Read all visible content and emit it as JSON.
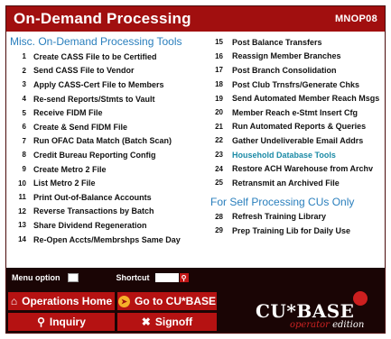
{
  "header": {
    "title": "On-Demand Processing",
    "code": "MNOP08"
  },
  "left": {
    "heading": "Misc. On-Demand Processing Tools",
    "items": [
      {
        "num": "1",
        "label": "Create CASS File to be Certified"
      },
      {
        "num": "2",
        "label": "Send CASS File to Vendor"
      },
      {
        "num": "3",
        "label": "Apply CASS-Cert File to Members"
      },
      {
        "num": "4",
        "label": "Re-send Reports/Stmts to Vault"
      },
      {
        "num": "5",
        "label": "Receive FIDM File"
      },
      {
        "num": "6",
        "label": "Create & Send FIDM File"
      },
      {
        "num": "7",
        "label": "Run OFAC Data Match (Batch Scan)"
      },
      {
        "num": "8",
        "label": "Credit Bureau Reporting Config"
      },
      {
        "num": "9",
        "label": "Create Metro 2 File"
      },
      {
        "num": "10",
        "label": "List Metro 2 File"
      },
      {
        "num": "11",
        "label": "Print Out-of-Balance Accounts"
      },
      {
        "num": "12",
        "label": "Reverse Transactions by Batch"
      },
      {
        "num": "13",
        "label": "Share Dividend Regeneration"
      },
      {
        "num": "14",
        "label": "Re-Open Accts/Membrshps Same Day"
      }
    ]
  },
  "right": {
    "items": [
      {
        "num": "15",
        "label": "Post Balance Transfers"
      },
      {
        "num": "16",
        "label": "Reassign Member Branches"
      },
      {
        "num": "17",
        "label": "Post Branch Consolidation"
      },
      {
        "num": "18",
        "label": "Post Club Trnsfrs/Generate Chks"
      },
      {
        "num": "19",
        "label": "Send Automated Member Reach Msgs"
      },
      {
        "num": "20",
        "label": "Member Reach e-Stmt Insert Cfg"
      },
      {
        "num": "21",
        "label": "Run Automated Reports & Queries"
      },
      {
        "num": "22",
        "label": "Gather Undeliverable Email Addrs"
      },
      {
        "num": "23",
        "label": "Household Database Tools"
      },
      {
        "num": "24",
        "label": "Restore ACH Warehouse from Archv"
      },
      {
        "num": "25",
        "label": "Retransmit an Archived File"
      }
    ],
    "heading2": "For Self Processing CUs Only",
    "items2": [
      {
        "num": "28",
        "label": "Refresh Training Library"
      },
      {
        "num": "29",
        "label": "Prep Training Lib for Daily Use"
      }
    ]
  },
  "status": {
    "menu_option_label": "Menu option",
    "shortcut_label": "Shortcut"
  },
  "footer": {
    "ops_home": "Operations Home",
    "go_to": "Go to CU*BASE",
    "inquiry": "Inquiry",
    "signoff": "Signoff"
  },
  "logo": {
    "main": "CU*BASE",
    "sub_a": "operator",
    "sub_b": "edition"
  },
  "colors": {
    "title_bar": "#a10f0f",
    "link_blue": "#2a7fbd",
    "highlight_teal": "#1b8aa6",
    "footer_bg": "#1a0505",
    "button_red": "#b51212"
  },
  "icons": {
    "home": "home-icon",
    "go": "cubase-go-icon",
    "inquiry": "search-icon",
    "signoff": "x-icon",
    "shortcut_go": "search-icon"
  }
}
